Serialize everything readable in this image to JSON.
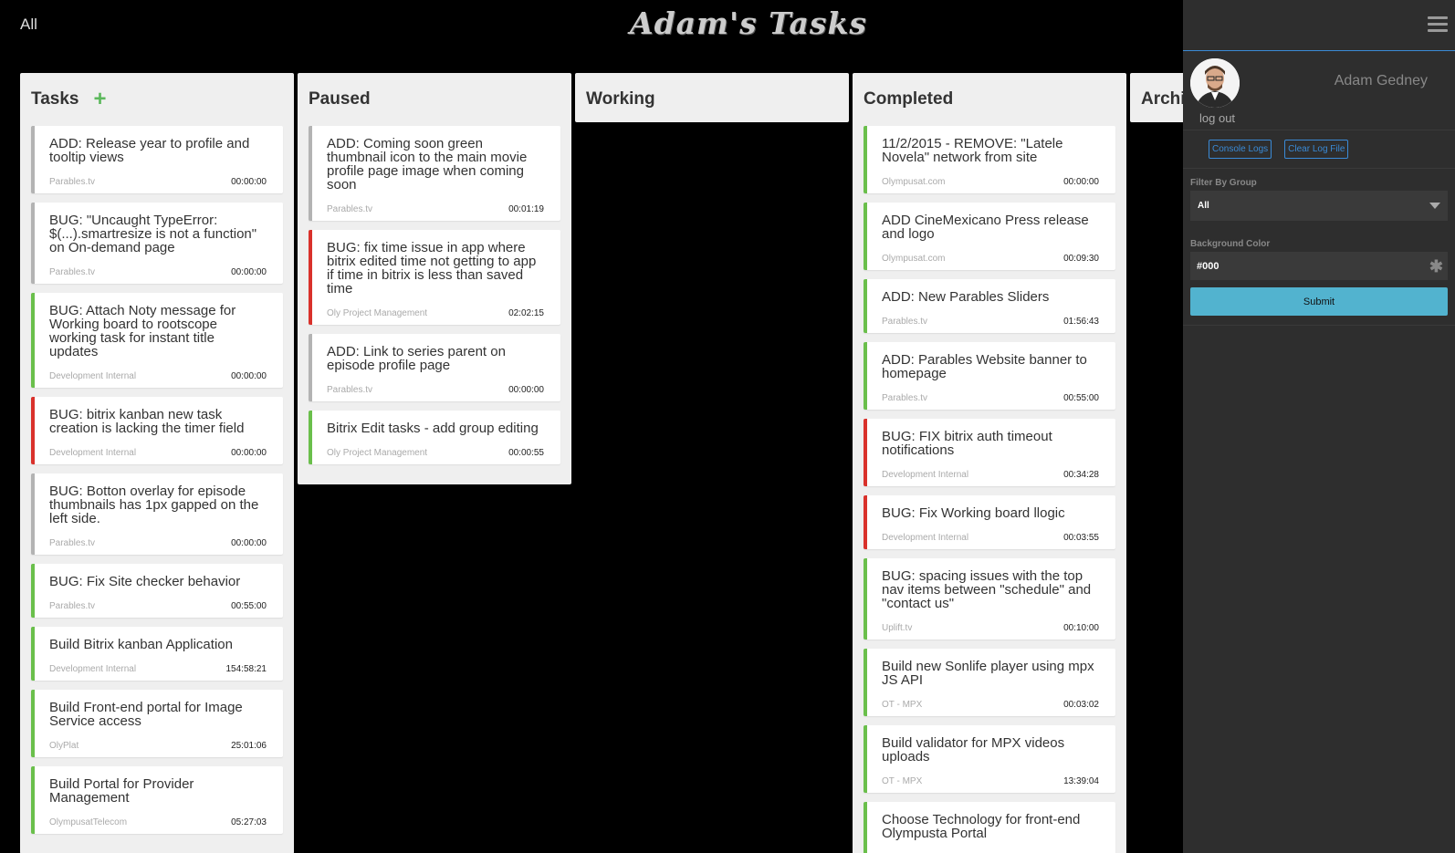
{
  "header": {
    "filter_label": "All",
    "title": "Adam's Tasks"
  },
  "columns": [
    {
      "title": "Tasks",
      "cards": [
        {
          "title": "ADD: Release year to profile and tooltip views",
          "group": "Parables.tv",
          "time": "00:00:00",
          "color": "grey"
        },
        {
          "title": "BUG: \"Uncaught TypeError: $(...).smartresize is not a function\" on On-demand page",
          "group": "Parables.tv",
          "time": "00:00:00",
          "color": "grey"
        },
        {
          "title": "BUG: Attach Noty message for Working board to rootscope working task for instant title updates",
          "group": "Development Internal",
          "time": "00:00:00",
          "color": "green"
        },
        {
          "title": "BUG: bitrix kanban new task creation is lacking the timer field",
          "group": "Development Internal",
          "time": "00:00:00",
          "color": "red"
        },
        {
          "title": "BUG: Botton overlay for episode thumbnails has 1px gapped on the left side.",
          "group": "Parables.tv",
          "time": "00:00:00",
          "color": "grey"
        },
        {
          "title": "BUG: Fix Site checker behavior",
          "group": "Parables.tv",
          "time": "00:55:00",
          "color": "green"
        },
        {
          "title": "Build Bitrix kanban Application",
          "group": "Development Internal",
          "time": "154:58:21",
          "color": "green"
        },
        {
          "title": "Build Front-end portal for Image Service access",
          "group": "OlyPlat",
          "time": "25:01:06",
          "color": "green"
        },
        {
          "title": "Build Portal for Provider Management",
          "group": "OlympusatTelecom",
          "time": "05:27:03",
          "color": "green"
        }
      ]
    },
    {
      "title": "Paused",
      "cards": [
        {
          "title": "ADD: Coming soon green thumbnail icon to the main movie profile page image when coming soon",
          "group": "Parables.tv",
          "time": "00:01:19",
          "color": "grey"
        },
        {
          "title": "BUG: fix time issue in app where bitrix edited time not getting to app if time in bitrix is less than saved time",
          "group": "Oly Project Management",
          "time": "02:02:15",
          "color": "red"
        },
        {
          "title": "ADD: Link to series parent on episode profile page",
          "group": "Parables.tv",
          "time": "00:00:00",
          "color": "grey"
        },
        {
          "title": "Bitrix Edit tasks - add group editing",
          "group": "Oly Project Management",
          "time": "00:00:55",
          "color": "green"
        }
      ]
    },
    {
      "title": "Working",
      "cards": []
    },
    {
      "title": "Completed",
      "cards": [
        {
          "title": "11/2/2015 - REMOVE: \"Latele Novela\" network from site",
          "group": "Olympusat.com",
          "time": "00:00:00",
          "color": "green"
        },
        {
          "title": "ADD CineMexicano Press release and logo",
          "group": "Olympusat.com",
          "time": "00:09:30",
          "color": "green"
        },
        {
          "title": "ADD: New Parables Sliders",
          "group": "Parables.tv",
          "time": "01:56:43",
          "color": "green"
        },
        {
          "title": "ADD: Parables Website banner to homepage",
          "group": "Parables.tv",
          "time": "00:55:00",
          "color": "green"
        },
        {
          "title": "BUG: FIX bitrix auth timeout notifications",
          "group": "Development Internal",
          "time": "00:34:28",
          "color": "red"
        },
        {
          "title": "BUG: Fix Working board llogic",
          "group": "Development Internal",
          "time": "00:03:55",
          "color": "red"
        },
        {
          "title": "BUG: spacing issues with the top nav items between \"schedule\" and \"contact us\"",
          "group": "Uplift.tv",
          "time": "00:10:00",
          "color": "green"
        },
        {
          "title": "Build new Sonlife player using mpx JS API",
          "group": "OT - MPX",
          "time": "00:03:02",
          "color": "green"
        },
        {
          "title": "Build validator for MPX videos uploads",
          "group": "OT - MPX",
          "time": "13:39:04",
          "color": "green"
        },
        {
          "title": "Choose Technology for front-end Olympusta Portal",
          "group": "",
          "time": "",
          "color": "green"
        }
      ]
    },
    {
      "title": "Archive",
      "cards": []
    }
  ],
  "sidebar": {
    "user_name": "Adam Gedney",
    "logout_label": "log out",
    "console_logs_label": "Console Logs",
    "clear_log_label": "Clear Log File",
    "filter_label": "Filter By Group",
    "filter_value": "All",
    "bg_color_label": "Background Color",
    "bg_color_value": "#000",
    "submit_label": "Submit"
  }
}
